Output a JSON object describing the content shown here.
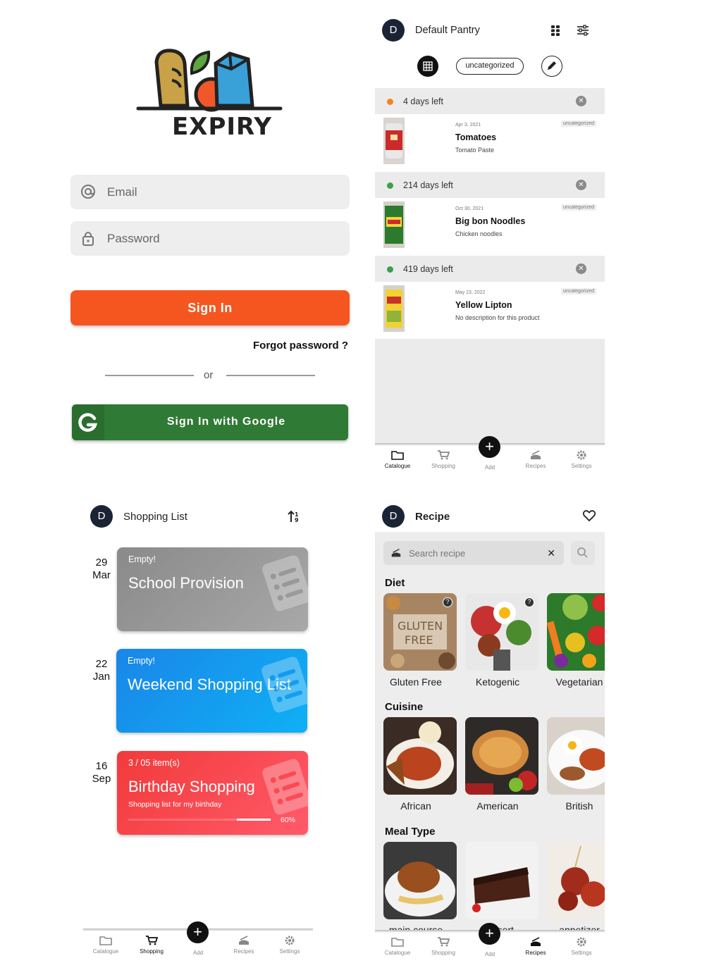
{
  "login": {
    "logo_text": "EXPIRY",
    "email_placeholder": "Email",
    "password_placeholder": "Password",
    "signin_label": "Sign In",
    "forgot_label": "Forgot password ?",
    "or_label": "or",
    "google_label": "Sign In with Google"
  },
  "pantry": {
    "avatar": "D",
    "title": "Default Pantry",
    "category_pill": "uncategorized",
    "groups": [
      {
        "label": "4 days left",
        "status_color": "#f5821f",
        "item": {
          "date": "Apr 3, 2021",
          "name": "Tomatoes",
          "desc": "Tomato Paste",
          "tag": "uncategorized"
        }
      },
      {
        "label": "214 days left",
        "status_color": "#3aa14a",
        "item": {
          "date": "Oct 30, 2021",
          "name": "Big bon Noodles",
          "desc": "Chicken noodles",
          "tag": "uncategorized"
        }
      },
      {
        "label": "419 days left",
        "status_color": "#3aa14a",
        "item": {
          "date": "May 23, 2022",
          "name": "Yellow Lipton",
          "desc": "No description for this product",
          "tag": "uncategorized"
        }
      }
    ]
  },
  "nav": {
    "items": [
      "Catalogue",
      "Shopping",
      "Add",
      "Recipes",
      "Settings"
    ]
  },
  "shopping": {
    "avatar": "D",
    "title": "Shopping List",
    "lists": [
      {
        "day": "29",
        "month": "Mar",
        "status": "Empty!",
        "title": "School Provision",
        "note": "",
        "progress_label": ""
      },
      {
        "day": "22",
        "month": "Jan",
        "status": "Empty!",
        "title": "Weekend Shopping List",
        "note": "",
        "progress_label": ""
      },
      {
        "day": "16",
        "month": "Sep",
        "status": "3 / 05 item(s)",
        "title": "Birthday Shopping",
        "note": "Shopping list for my birthday",
        "progress_label": "60%",
        "progress": 0.6
      }
    ]
  },
  "recipe": {
    "avatar": "D",
    "title": "Recipe",
    "search_placeholder": "Search recipe",
    "sections": [
      {
        "name": "Diet",
        "items": [
          "Gluten Free",
          "Ketogenic",
          "Vegetarian"
        ]
      },
      {
        "name": "Cuisine",
        "items": [
          "African",
          "American",
          "British"
        ]
      },
      {
        "name": "Meal Type",
        "items": [
          "main course",
          "dessert",
          "appetizer"
        ]
      }
    ]
  }
}
